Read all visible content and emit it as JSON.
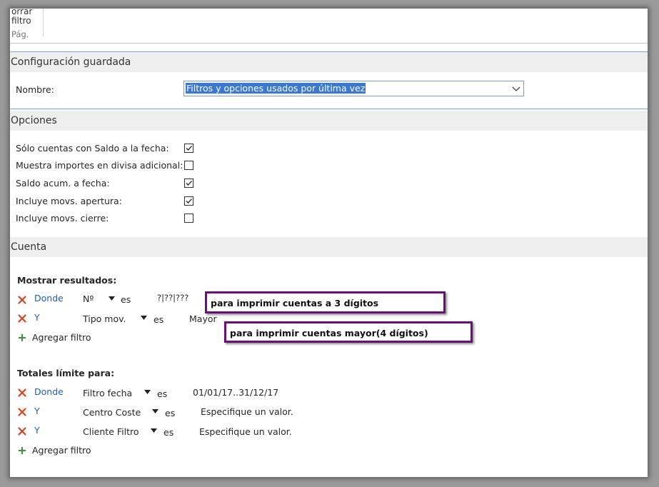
{
  "ribbon": {
    "line1": "orrar",
    "line2": "filtro",
    "page": "Pág."
  },
  "sections": {
    "config_title": "Configuración guardada",
    "options_title": "Opciones",
    "account_title": "Cuenta"
  },
  "config": {
    "name_label": "Nombre:",
    "name_value": "Filtros y opciones usados por última vez"
  },
  "options": [
    {
      "label": "Sólo cuentas con Saldo a la fecha:",
      "checked": true
    },
    {
      "label": "Muestra importes en divisa adicional:",
      "checked": false
    },
    {
      "label": "Saldo acum. a fecha:",
      "checked": true
    },
    {
      "label": "Incluye movs. apertura:",
      "checked": true
    },
    {
      "label": "Incluye movs. cierre:",
      "checked": false
    }
  ],
  "show_results": {
    "title": "Mostrar resultados:",
    "filters": [
      {
        "connector": "Donde",
        "field": "Nº",
        "op": "es",
        "value": "?|??|???"
      },
      {
        "connector": "Y",
        "field": "Tipo mov.",
        "op": "es",
        "value": "Mayor"
      }
    ],
    "add_label": "Agregar filtro"
  },
  "limit_totals": {
    "title": "Totales límite para:",
    "filters": [
      {
        "connector": "Donde",
        "field": "Filtro fecha",
        "op": "es",
        "value": "01/01/17..31/12/17"
      },
      {
        "connector": "Y",
        "field": "Centro Coste",
        "op": "es",
        "value": "Especifique un valor."
      },
      {
        "connector": "Y",
        "field": "Cliente Filtro",
        "op": "es",
        "value": "Especifique un valor."
      }
    ],
    "add_label": "Agregar filtro"
  },
  "annotations": {
    "note1": "para imprimir cuentas a 3 dígitos",
    "note2": "para imprimir cuentas mayor(4 dígitos)"
  },
  "colors": {
    "accent_blue": "#1f5fbf",
    "remove_red": "#d9431e",
    "add_green": "#4a8c4a",
    "callout_border": "#6a0f77"
  },
  "icons": {
    "remove": "close-x-icon",
    "add": "plus-icon",
    "dropdown": "chevron-down-icon",
    "checkbox": "checkmark-icon"
  }
}
